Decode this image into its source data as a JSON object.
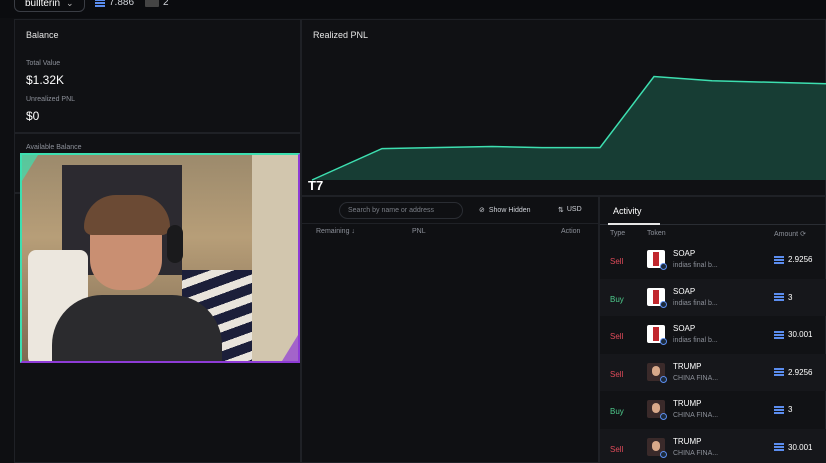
{
  "topbar": {
    "wallet_label": "bullterin",
    "sol_balance": "7.886",
    "count": "2"
  },
  "balance": {
    "title": "Balance",
    "total_value_label": "Total Value",
    "total_value": "$1.32K",
    "unrealized_label": "Unrealized PNL",
    "unrealized_value": "$0",
    "available_label": "Available Balance"
  },
  "chart": {
    "title": "Realized PNL",
    "watermark": "T7",
    "fill_color": "#173d34",
    "line_color": "#3ddfb0"
  },
  "chart_data": {
    "type": "area",
    "title": "Realized PNL",
    "x": [
      0,
      1,
      2,
      3,
      4,
      5,
      6,
      7
    ],
    "values": [
      0,
      30,
      31,
      32,
      31,
      31,
      99,
      95,
      92
    ],
    "ylim": [
      0,
      110
    ],
    "grid": false
  },
  "positions": {
    "search_placeholder": "Search by name or address",
    "show_hidden": "Show Hidden",
    "currency": "USD",
    "columns": [
      "Remaining",
      "PNL",
      "Action"
    ]
  },
  "activity": {
    "tab": "Activity",
    "columns": [
      "Type",
      "Token",
      "Amount"
    ],
    "rows": [
      {
        "type": "Sell",
        "token": "SOAP",
        "desc": "indias final b...",
        "amount": "2.9256",
        "icon": "soap"
      },
      {
        "type": "Buy",
        "token": "SOAP",
        "desc": "indias final b...",
        "amount": "3",
        "icon": "soap"
      },
      {
        "type": "Sell",
        "token": "SOAP",
        "desc": "indias final b...",
        "amount": "30.001",
        "icon": "soap"
      },
      {
        "type": "Sell",
        "token": "TRUMP",
        "desc": "CHINA FINA...",
        "amount": "2.9256",
        "icon": "trump"
      },
      {
        "type": "Buy",
        "token": "TRUMP",
        "desc": "CHINA FINA...",
        "amount": "3",
        "icon": "trump"
      },
      {
        "type": "Sell",
        "token": "TRUMP",
        "desc": "CHINA FINA...",
        "amount": "30.001",
        "icon": "trump"
      }
    ]
  }
}
